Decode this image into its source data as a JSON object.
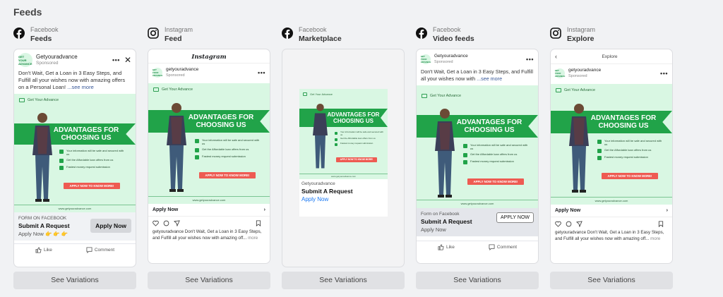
{
  "section_title": "Feeds",
  "columns": [
    {
      "platform": "Facebook",
      "placement": "Feeds",
      "icon": "facebook-icon"
    },
    {
      "platform": "Instagram",
      "placement": "Feed",
      "icon": "instagram-icon"
    },
    {
      "platform": "Facebook",
      "placement": "Marketplace",
      "icon": "facebook-icon"
    },
    {
      "platform": "Facebook",
      "placement": "Video feeds",
      "icon": "facebook-icon"
    },
    {
      "platform": "Instagram",
      "placement": "Explore",
      "icon": "instagram-icon"
    }
  ],
  "ad": {
    "advertiser": "Getyouradvance",
    "advertiser_ig": "getyouradvance",
    "sponsored": "Sponsored",
    "logo_text": "GET YOUR ADVANCE",
    "primary_text": "Don't Wait, Get a Loan in 3 Easy Steps, and Fulfill all your wishes now with amazing offers on a Personal Loan!",
    "primary_text_short": "Don't Wait, Get a Loan in 3 Easy Steps, and Fulfill all your wishes now with",
    "see_more": "...see more",
    "creative": {
      "brand": "Get Your Advance",
      "headline": "ADVANTAGES FOR CHOOSING US",
      "bullets": [
        "Your information will be safe and secured with us",
        "Get the Affordable loan offers from us",
        "Fastest money request submission"
      ],
      "button": "APPLY NOW TO KNOW MORE!",
      "website": "www.getyouradvance.com"
    },
    "form_label": "FORM ON FACEBOOK",
    "form_label_title": "Form on Facebook",
    "cta_title": "Submit A Request",
    "apply_now": "Apply Now",
    "apply_now_upper": "APPLY NOW",
    "emojis": "👉 👉 👉",
    "like": "Like",
    "comment": "Comment",
    "ig_caption_user": "getyouradvance",
    "ig_caption": "Don't Wait, Get a Loan in 3 Easy Steps, and Fulfill all your wishes now with amazing off...",
    "ig_more": "more",
    "ig_logo": "Instagram",
    "explore_title": "Explore"
  },
  "see_variations": "See Variations",
  "colors": {
    "green": "#21a349",
    "mint": "#d9f7e3",
    "coral": "#ee5b52"
  }
}
